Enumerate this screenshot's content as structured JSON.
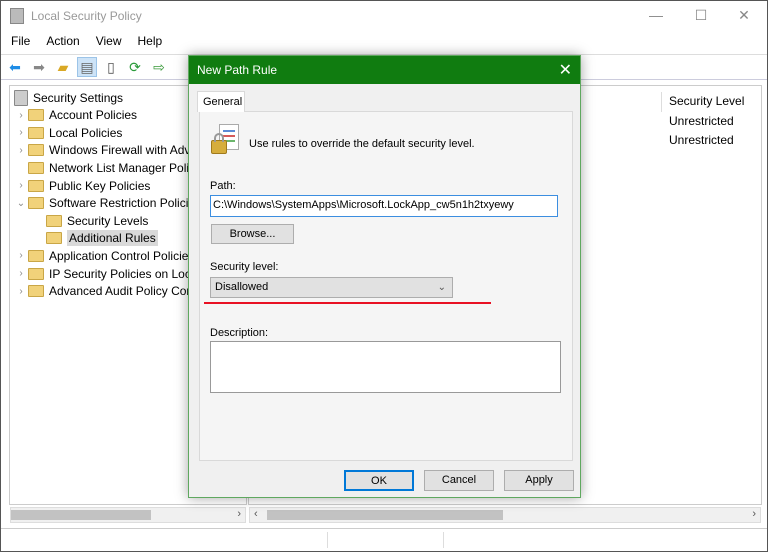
{
  "window": {
    "title": "Local Security Policy",
    "controls": {
      "minimize": "—",
      "maximize": "☐",
      "close": "✕"
    }
  },
  "menu": [
    "File",
    "Action",
    "View",
    "Help"
  ],
  "toolbar": [
    "back-icon",
    "forward-icon",
    "up-folder-icon",
    "show-hide-tree-icon",
    "clipboard-icon",
    "refresh-icon",
    "export-list-icon"
  ],
  "tree": [
    {
      "label": "Security Settings",
      "level": 0,
      "chevron": ""
    },
    {
      "label": "Account Policies",
      "level": 1,
      "chevron": "›"
    },
    {
      "label": "Local Policies",
      "level": 1,
      "chevron": "›"
    },
    {
      "label": "Windows Firewall with Advanced Security",
      "level": 1,
      "chevron": "›"
    },
    {
      "label": "Network List Manager Policies",
      "level": 1,
      "chevron": ""
    },
    {
      "label": "Public Key Policies",
      "level": 1,
      "chevron": "›"
    },
    {
      "label": "Software Restriction Policies",
      "level": 1,
      "chevron": "⌄"
    },
    {
      "label": "Security Levels",
      "level": 2,
      "chevron": ""
    },
    {
      "label": "Additional Rules",
      "level": 2,
      "chevron": "",
      "selected": true
    },
    {
      "label": "Application Control Policies",
      "level": 1,
      "chevron": "›"
    },
    {
      "label": "IP Security Policies on Local Computer",
      "level": 1,
      "chevron": "›"
    },
    {
      "label": "Advanced Audit Policy Configuration",
      "level": 1,
      "chevron": "›"
    }
  ],
  "list": {
    "column": "Security Level",
    "rows": [
      "Unrestricted",
      "Unrestricted"
    ]
  },
  "dialog": {
    "title": "New Path Rule",
    "close": "✕",
    "tab": "General",
    "intro": "Use rules to override the default security level.",
    "path_label": "Path:",
    "path_value": "C:\\Windows\\SystemApps\\Microsoft.LockApp_cw5n1h2txyewy",
    "browse": "Browse...",
    "security_label": "Security level:",
    "security_value": "Disallowed",
    "description_label": "Description:",
    "description_value": "",
    "ok": "OK",
    "cancel": "Cancel",
    "apply": "Apply"
  },
  "colors": {
    "dialog_title": "#107c10",
    "highlight_line": "#e81123",
    "selection": "#d9d9d9"
  }
}
